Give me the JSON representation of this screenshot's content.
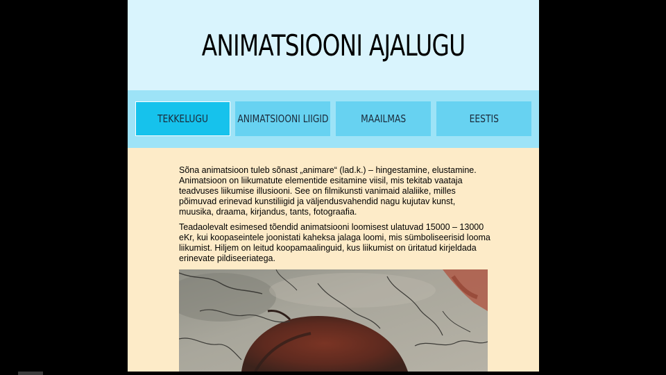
{
  "header": {
    "title": "ANIMATSIOONI AJALUGU"
  },
  "nav": {
    "items": [
      {
        "label": "TEKKELUGU"
      },
      {
        "label": "ANIMATSIOONI LIIGID"
      },
      {
        "label": "MAAILMAS"
      },
      {
        "label": "EESTIS"
      }
    ]
  },
  "content": {
    "paragraphs": [
      "Sõna animatsioon tuleb sõnast „animare“ (lad.k.) – hingestamine, elustamine. Animatsioon on liikumatute elementide esitamine viisil, mis tekitab vaataja teadvuses liikumise illusiooni. See on filmikunsti vanimaid alaliike, milles põimuvad erinevad kunstiliigid ja väljendusvahendid nagu kujutav kunst, muusika, draama, kirjandus, tants, fotograafia.",
      "Teadaolevalt esimesed tõendid animatsiooni loomisest ulatuvad 15000 – 13000 eKr, kui koopaseintele joonistati kaheksa jalaga loomi, mis sümboliseerisid looma liikumist. Hiljem on leitud koopamaalinguid, kus liikumist on üritatud kirjeldada erinevate pildiseeriatega."
    ]
  },
  "colors": {
    "header_bg": "#d9f4fd",
    "nav_bg": "#9de3f7",
    "nav_item": "#67d2f1",
    "nav_item_active": "#16c2ec",
    "content_bg": "#fdebc8"
  }
}
